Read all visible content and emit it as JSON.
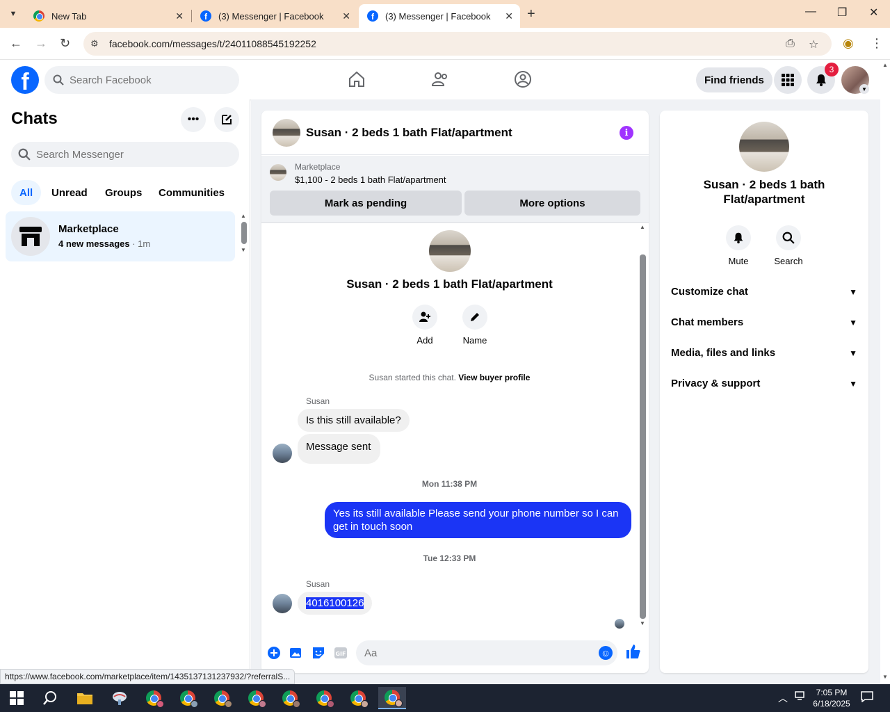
{
  "browser": {
    "tabs": [
      {
        "title": "New Tab",
        "icon": "chrome-icon"
      },
      {
        "title": "(3) Messenger | Facebook",
        "icon": "facebook-icon"
      },
      {
        "title": "(3) Messenger | Facebook",
        "icon": "facebook-icon",
        "active": true
      }
    ],
    "url": "facebook.com/messages/t/24011088545192252",
    "status_url": "https://www.facebook.com/marketplace/item/1435137131237932/?referralS..."
  },
  "fb_nav": {
    "logo": "f",
    "search_placeholder": "Search Facebook",
    "find_friends_label": "Find friends",
    "notification_count": "3"
  },
  "chats": {
    "title": "Chats",
    "search_placeholder": "Search Messenger",
    "filters": [
      "All",
      "Unread",
      "Groups",
      "Communities"
    ],
    "items": [
      {
        "name": "Marketplace",
        "preview": "4 new messages",
        "time": " · 1m"
      }
    ]
  },
  "conversation": {
    "title": "Susan · 2 beds 1 bath Flat/apartment",
    "marketplace": {
      "label": "Marketplace",
      "listing": "$1,100 - 2 beds 1 bath Flat/apartment",
      "mark_pending_label": "Mark as pending",
      "more_options_label": "More options"
    },
    "profile_name": "Susan · 2 beds 1 bath Flat/apartment",
    "actions": [
      {
        "label": "Add",
        "icon": "add-person-icon"
      },
      {
        "label": "Name",
        "icon": "pencil-icon"
      }
    ],
    "system_text": "Susan started this chat.",
    "system_link": "View buyer profile",
    "messages": [
      {
        "sender": "Susan",
        "text": "Is this still available?"
      },
      {
        "text": "Message sent"
      },
      {
        "timestamp": "Mon 11:38 PM"
      },
      {
        "outgoing": true,
        "text": "Yes its still available Please send your phone number so I can get in touch soon"
      },
      {
        "timestamp": "Tue 12:33 PM"
      },
      {
        "sender": "Susan",
        "text": "4016100126",
        "selected": true
      }
    ],
    "composer_placeholder": "Aa"
  },
  "info_panel": {
    "name": "Susan · 2 beds 1 bath Flat/apartment",
    "actions": [
      {
        "label": "Mute",
        "icon": "bell-icon"
      },
      {
        "label": "Search",
        "icon": "search-icon"
      }
    ],
    "sections": [
      "Customize chat",
      "Chat members",
      "Media, files and links",
      "Privacy & support"
    ]
  },
  "taskbar": {
    "time": "7:05 PM",
    "date": "6/18/2025"
  },
  "colors": {
    "facebook_blue": "#0866ff",
    "outgoing_bubble": "#1b35f5",
    "notification_red": "#e41e3f",
    "info_purple": "#a033ff",
    "tab_bar": "#f8dfc8"
  }
}
